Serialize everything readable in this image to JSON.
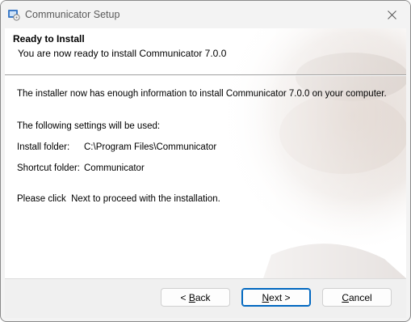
{
  "window": {
    "title": "Communicator Setup",
    "icon": "installer-icon",
    "close_icon": "close-icon"
  },
  "header": {
    "title": "Ready to Install",
    "subtitle": "You are now ready to install Communicator 7.0.0"
  },
  "body": {
    "intro": "The installer now has enough information to install Communicator 7.0.0 on your computer.",
    "settings_heading": "The following settings will be used:",
    "install_folder_label": "Install folder:",
    "install_folder_value": "C:\\Program Files\\Communicator",
    "shortcut_folder_label": "Shortcut folder:",
    "shortcut_folder_value": "Communicator",
    "proceed_text": "Please click  Next to proceed with the installation."
  },
  "buttons": {
    "back": {
      "mnemonic": "B",
      "rest": "ack",
      "prefix": "< "
    },
    "next": {
      "mnemonic": "N",
      "rest": "ext",
      "suffix": " >"
    },
    "cancel": {
      "mnemonic": "C",
      "rest": "ancel"
    }
  },
  "colors": {
    "accent": "#0067c0",
    "face_tint": "#e4dbd6"
  }
}
